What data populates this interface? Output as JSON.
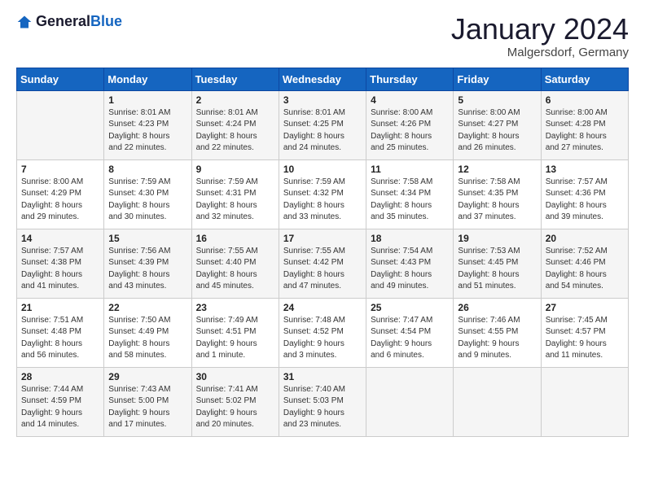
{
  "logo": {
    "text_general": "General",
    "text_blue": "Blue"
  },
  "title": {
    "month_year": "January 2024",
    "location": "Malgersdorf, Germany"
  },
  "days_of_week": [
    "Sunday",
    "Monday",
    "Tuesday",
    "Wednesday",
    "Thursday",
    "Friday",
    "Saturday"
  ],
  "weeks": [
    [
      {
        "day": "",
        "info": ""
      },
      {
        "day": "1",
        "info": "Sunrise: 8:01 AM\nSunset: 4:23 PM\nDaylight: 8 hours\nand 22 minutes."
      },
      {
        "day": "2",
        "info": "Sunrise: 8:01 AM\nSunset: 4:24 PM\nDaylight: 8 hours\nand 22 minutes."
      },
      {
        "day": "3",
        "info": "Sunrise: 8:01 AM\nSunset: 4:25 PM\nDaylight: 8 hours\nand 24 minutes."
      },
      {
        "day": "4",
        "info": "Sunrise: 8:00 AM\nSunset: 4:26 PM\nDaylight: 8 hours\nand 25 minutes."
      },
      {
        "day": "5",
        "info": "Sunrise: 8:00 AM\nSunset: 4:27 PM\nDaylight: 8 hours\nand 26 minutes."
      },
      {
        "day": "6",
        "info": "Sunrise: 8:00 AM\nSunset: 4:28 PM\nDaylight: 8 hours\nand 27 minutes."
      }
    ],
    [
      {
        "day": "7",
        "info": "Sunrise: 8:00 AM\nSunset: 4:29 PM\nDaylight: 8 hours\nand 29 minutes."
      },
      {
        "day": "8",
        "info": "Sunrise: 7:59 AM\nSunset: 4:30 PM\nDaylight: 8 hours\nand 30 minutes."
      },
      {
        "day": "9",
        "info": "Sunrise: 7:59 AM\nSunset: 4:31 PM\nDaylight: 8 hours\nand 32 minutes."
      },
      {
        "day": "10",
        "info": "Sunrise: 7:59 AM\nSunset: 4:32 PM\nDaylight: 8 hours\nand 33 minutes."
      },
      {
        "day": "11",
        "info": "Sunrise: 7:58 AM\nSunset: 4:34 PM\nDaylight: 8 hours\nand 35 minutes."
      },
      {
        "day": "12",
        "info": "Sunrise: 7:58 AM\nSunset: 4:35 PM\nDaylight: 8 hours\nand 37 minutes."
      },
      {
        "day": "13",
        "info": "Sunrise: 7:57 AM\nSunset: 4:36 PM\nDaylight: 8 hours\nand 39 minutes."
      }
    ],
    [
      {
        "day": "14",
        "info": "Sunrise: 7:57 AM\nSunset: 4:38 PM\nDaylight: 8 hours\nand 41 minutes."
      },
      {
        "day": "15",
        "info": "Sunrise: 7:56 AM\nSunset: 4:39 PM\nDaylight: 8 hours\nand 43 minutes."
      },
      {
        "day": "16",
        "info": "Sunrise: 7:55 AM\nSunset: 4:40 PM\nDaylight: 8 hours\nand 45 minutes."
      },
      {
        "day": "17",
        "info": "Sunrise: 7:55 AM\nSunset: 4:42 PM\nDaylight: 8 hours\nand 47 minutes."
      },
      {
        "day": "18",
        "info": "Sunrise: 7:54 AM\nSunset: 4:43 PM\nDaylight: 8 hours\nand 49 minutes."
      },
      {
        "day": "19",
        "info": "Sunrise: 7:53 AM\nSunset: 4:45 PM\nDaylight: 8 hours\nand 51 minutes."
      },
      {
        "day": "20",
        "info": "Sunrise: 7:52 AM\nSunset: 4:46 PM\nDaylight: 8 hours\nand 54 minutes."
      }
    ],
    [
      {
        "day": "21",
        "info": "Sunrise: 7:51 AM\nSunset: 4:48 PM\nDaylight: 8 hours\nand 56 minutes."
      },
      {
        "day": "22",
        "info": "Sunrise: 7:50 AM\nSunset: 4:49 PM\nDaylight: 8 hours\nand 58 minutes."
      },
      {
        "day": "23",
        "info": "Sunrise: 7:49 AM\nSunset: 4:51 PM\nDaylight: 9 hours\nand 1 minute."
      },
      {
        "day": "24",
        "info": "Sunrise: 7:48 AM\nSunset: 4:52 PM\nDaylight: 9 hours\nand 3 minutes."
      },
      {
        "day": "25",
        "info": "Sunrise: 7:47 AM\nSunset: 4:54 PM\nDaylight: 9 hours\nand 6 minutes."
      },
      {
        "day": "26",
        "info": "Sunrise: 7:46 AM\nSunset: 4:55 PM\nDaylight: 9 hours\nand 9 minutes."
      },
      {
        "day": "27",
        "info": "Sunrise: 7:45 AM\nSunset: 4:57 PM\nDaylight: 9 hours\nand 11 minutes."
      }
    ],
    [
      {
        "day": "28",
        "info": "Sunrise: 7:44 AM\nSunset: 4:59 PM\nDaylight: 9 hours\nand 14 minutes."
      },
      {
        "day": "29",
        "info": "Sunrise: 7:43 AM\nSunset: 5:00 PM\nDaylight: 9 hours\nand 17 minutes."
      },
      {
        "day": "30",
        "info": "Sunrise: 7:41 AM\nSunset: 5:02 PM\nDaylight: 9 hours\nand 20 minutes."
      },
      {
        "day": "31",
        "info": "Sunrise: 7:40 AM\nSunset: 5:03 PM\nDaylight: 9 hours\nand 23 minutes."
      },
      {
        "day": "",
        "info": ""
      },
      {
        "day": "",
        "info": ""
      },
      {
        "day": "",
        "info": ""
      }
    ]
  ]
}
